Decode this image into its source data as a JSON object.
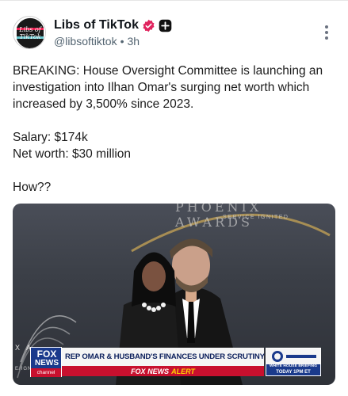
{
  "author": {
    "display_name": "Libs of TikTok",
    "handle": "@libsoftiktok",
    "separator": "•",
    "time": "3h",
    "avatar_text_line1": "Libs of",
    "avatar_text_line2": "TikTok"
  },
  "post": {
    "paragraph1": "BREAKING: House Oversight Committee is launching an investigation into Ilhan Omar's surging net worth which increased by 3,500% since 2023.",
    "salary": "Salary: $174k",
    "net_worth": "Net worth: $30 million",
    "closing": "How??"
  },
  "media": {
    "backdrop_text": "PHOENIX AWARDS",
    "backdrop_subtext": "SERVICE IGNITED",
    "left_partial": "X A",
    "left_partial2": "E IGN",
    "fox_top": "FOX",
    "fox_bottom": "NEWS",
    "fox_channel": "channel",
    "headline": "REP OMAR & HUSBAND'S FINANCES UNDER SCRUTINY",
    "alert_fox": "FOX NEWS",
    "alert_word": "ALERT",
    "briefing_line": "WHITE HOUSE BRIEFING",
    "briefing_time": "TODAY 1PM ET"
  },
  "colors": {
    "verified": "#e0245e",
    "fox_blue": "#1a3a8c",
    "alert_red": "#c8102e"
  },
  "icons": {
    "verified": "verified-badge-icon",
    "plus": "plus-badge-icon",
    "menu": "more-options-icon"
  }
}
